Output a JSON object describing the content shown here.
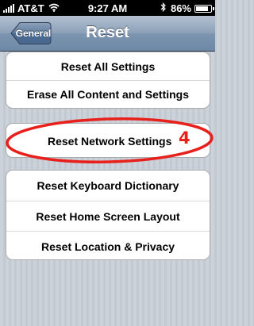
{
  "status_bar": {
    "carrier": "AT&T",
    "time": "9:27 AM",
    "battery": "86%",
    "battery_level": 0.86,
    "icons": [
      "signal-bars-icon",
      "wifi-icon",
      "bluetooth-icon",
      "battery-icon"
    ]
  },
  "nav": {
    "back_label": "General",
    "title": "Reset"
  },
  "group1": {
    "items": [
      "Reset All Settings",
      "Erase All Content and Settings"
    ]
  },
  "group2": {
    "items": [
      "Reset Network Settings"
    ]
  },
  "group3": {
    "items": [
      "Reset Keyboard Dictionary",
      "Reset Home Screen Layout",
      "Reset Location & Privacy"
    ]
  },
  "annotation": {
    "number": "4",
    "color": "#e8201c"
  },
  "colors": {
    "nav_bar": "#7c95b0",
    "background": "#c5ccd4"
  }
}
